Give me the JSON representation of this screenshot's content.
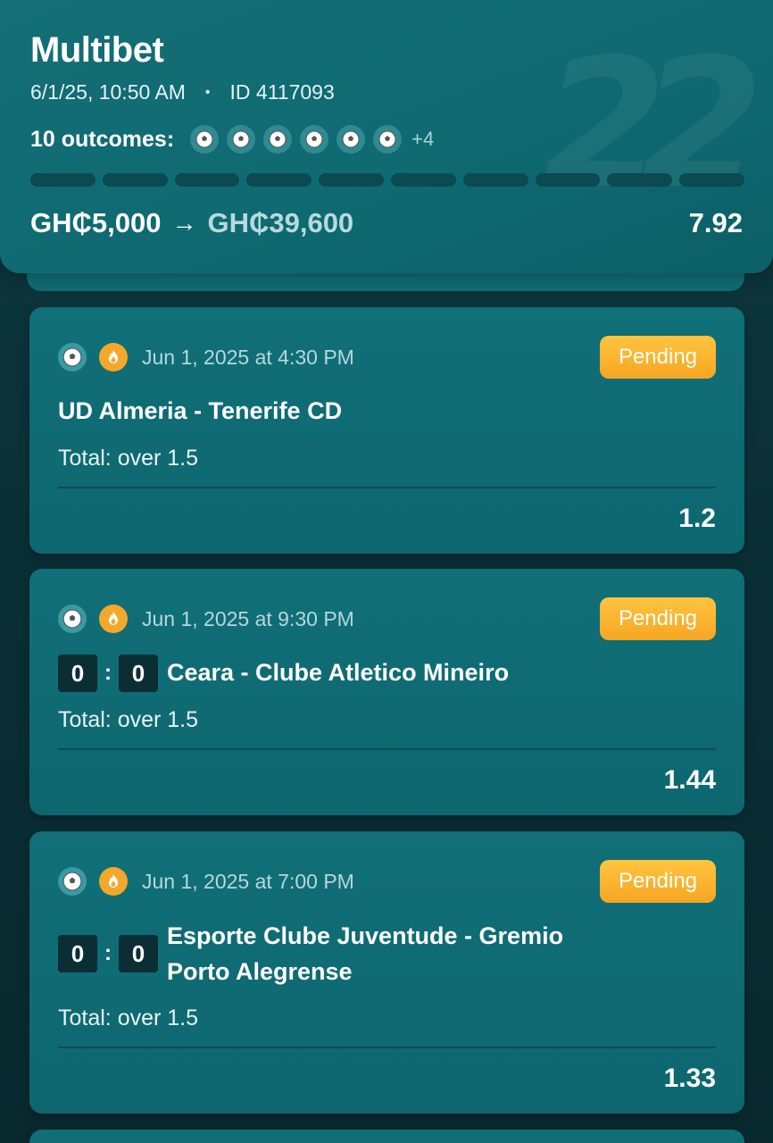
{
  "bet": {
    "title": "Multibet",
    "datetime": "6/1/25, 10:50 AM",
    "separator": "•",
    "id_label": "ID 4117093",
    "outcomes_label": "10 outcomes:",
    "outcomes_more": "+4",
    "stake": "GH₵5,000",
    "arrow": "→",
    "payout": "GH₵39,600",
    "total_odds": "7.92",
    "watermark": "22",
    "progress_segments": 10
  },
  "selections": [
    {
      "date": "Jun 1, 2025 at 4:30 PM",
      "status": "Pending",
      "match": "UD Almeria - Tenerife CD",
      "market": "Total: over 1.5",
      "odds": "1.2"
    },
    {
      "date": "Jun 1, 2025 at 9:30 PM",
      "status": "Pending",
      "score_home": "0",
      "score_away": "0",
      "score_sep": ":",
      "match": "Ceara - Clube Atletico Mineiro",
      "market": "Total: over 1.5",
      "odds": "1.44"
    },
    {
      "date": "Jun 1, 2025 at 7:00 PM",
      "status": "Pending",
      "score_home": "0",
      "score_away": "0",
      "score_sep": ":",
      "match": "Esporte Clube Juventude - Gremio Porto Alegrense",
      "market": "Total: over 1.5",
      "odds": "1.33"
    }
  ],
  "icons": {
    "sport": "soccer-ball-icon",
    "hot": "fire-icon"
  },
  "colors": {
    "pending": "#f6a623",
    "card": "#106f77",
    "background": "#0a2e33"
  }
}
